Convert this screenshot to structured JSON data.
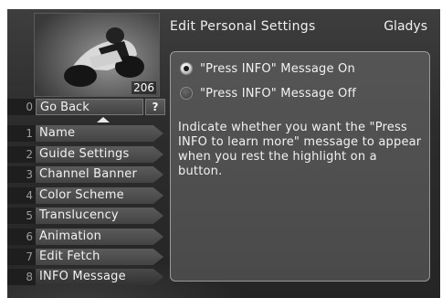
{
  "header": {
    "title": "Edit Personal Settings",
    "user": "Gladys"
  },
  "preview": {
    "channel": "206"
  },
  "nav": {
    "go_back": {
      "number": "0",
      "label": "Go Back",
      "help": "?"
    },
    "items": [
      {
        "number": "1",
        "label": "Name"
      },
      {
        "number": "2",
        "label": "Guide Settings"
      },
      {
        "number": "3",
        "label": "Channel Banner"
      },
      {
        "number": "4",
        "label": "Color Scheme"
      },
      {
        "number": "5",
        "label": "Translucency"
      },
      {
        "number": "6",
        "label": "Animation"
      },
      {
        "number": "7",
        "label": "Edit Fetch"
      },
      {
        "number": "8",
        "label": "INFO Message"
      }
    ]
  },
  "panel": {
    "options": [
      {
        "label": "\"Press INFO\" Message On",
        "selected": true
      },
      {
        "label": "\"Press INFO\" Message Off",
        "selected": false
      }
    ],
    "description": "Indicate whether you want the \"Press INFO to learn more\" message to appear when you rest the highlight on a button."
  },
  "colors": {
    "background": "#2e2e2e",
    "panel": "#4f4f4f",
    "text": "#f2f2f2",
    "number_text": "#9c9c9c"
  }
}
